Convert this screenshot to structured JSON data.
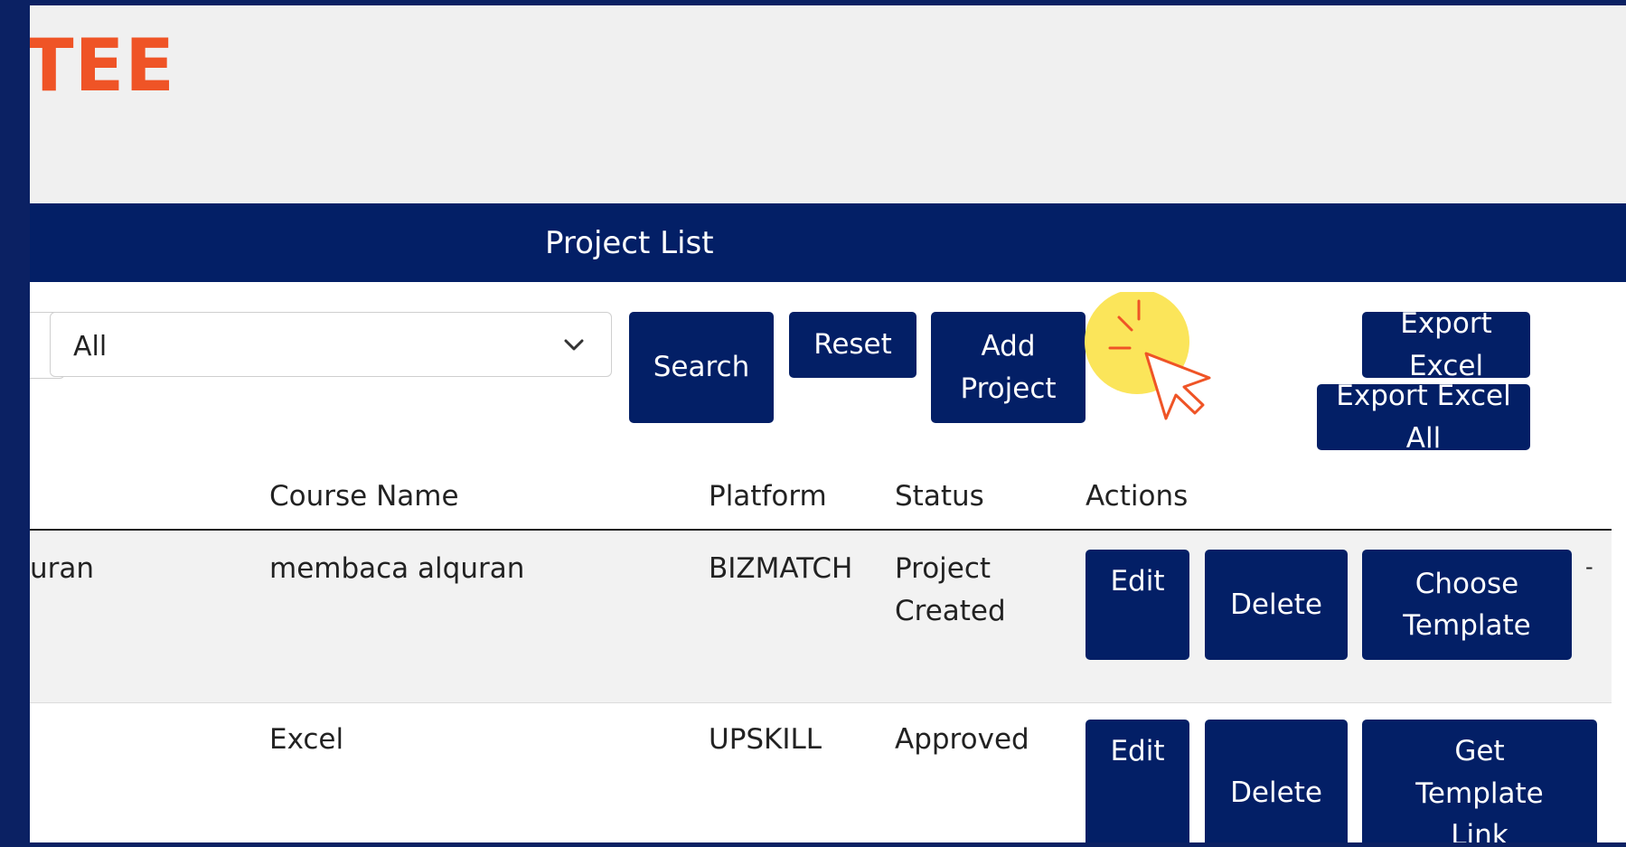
{
  "brand": {
    "text": "TEE"
  },
  "page": {
    "title": "Project List"
  },
  "filter": {
    "selected": "All"
  },
  "toolbar": {
    "search_label": "Search",
    "reset_label": "Reset",
    "add_project_label_line1": "Add",
    "add_project_label_line2": "Project",
    "export_excel_label": "Export Excel",
    "export_excel_all_label": "Export Excel All"
  },
  "table": {
    "columns": {
      "course_name": "Course Name",
      "platform": "Platform",
      "status": "Status",
      "actions": "Actions"
    },
    "rows": [
      {
        "title_partial": "uran",
        "course_name": "membaca alquran",
        "platform": "BIZMATCH",
        "status_line1": "Project",
        "status_line2": "Created",
        "edit_label": "Edit",
        "delete_label": "Delete",
        "action3_line1": "Choose",
        "action3_line2": "Template",
        "trailing": "-"
      },
      {
        "course_name": "Excel",
        "platform": "UPSKILL",
        "status": "Approved",
        "edit_label": "Edit",
        "delete_label": "Delete",
        "action3_line1": "Get",
        "action3_line2": "Template",
        "action3_line3": "Link"
      }
    ]
  },
  "colors": {
    "primary": "#031f66",
    "accent": "#ef5426",
    "highlight": "#fbe55a"
  },
  "icons": {
    "dropdown": "chevron-down-icon",
    "pointer": "cursor-click-icon"
  }
}
